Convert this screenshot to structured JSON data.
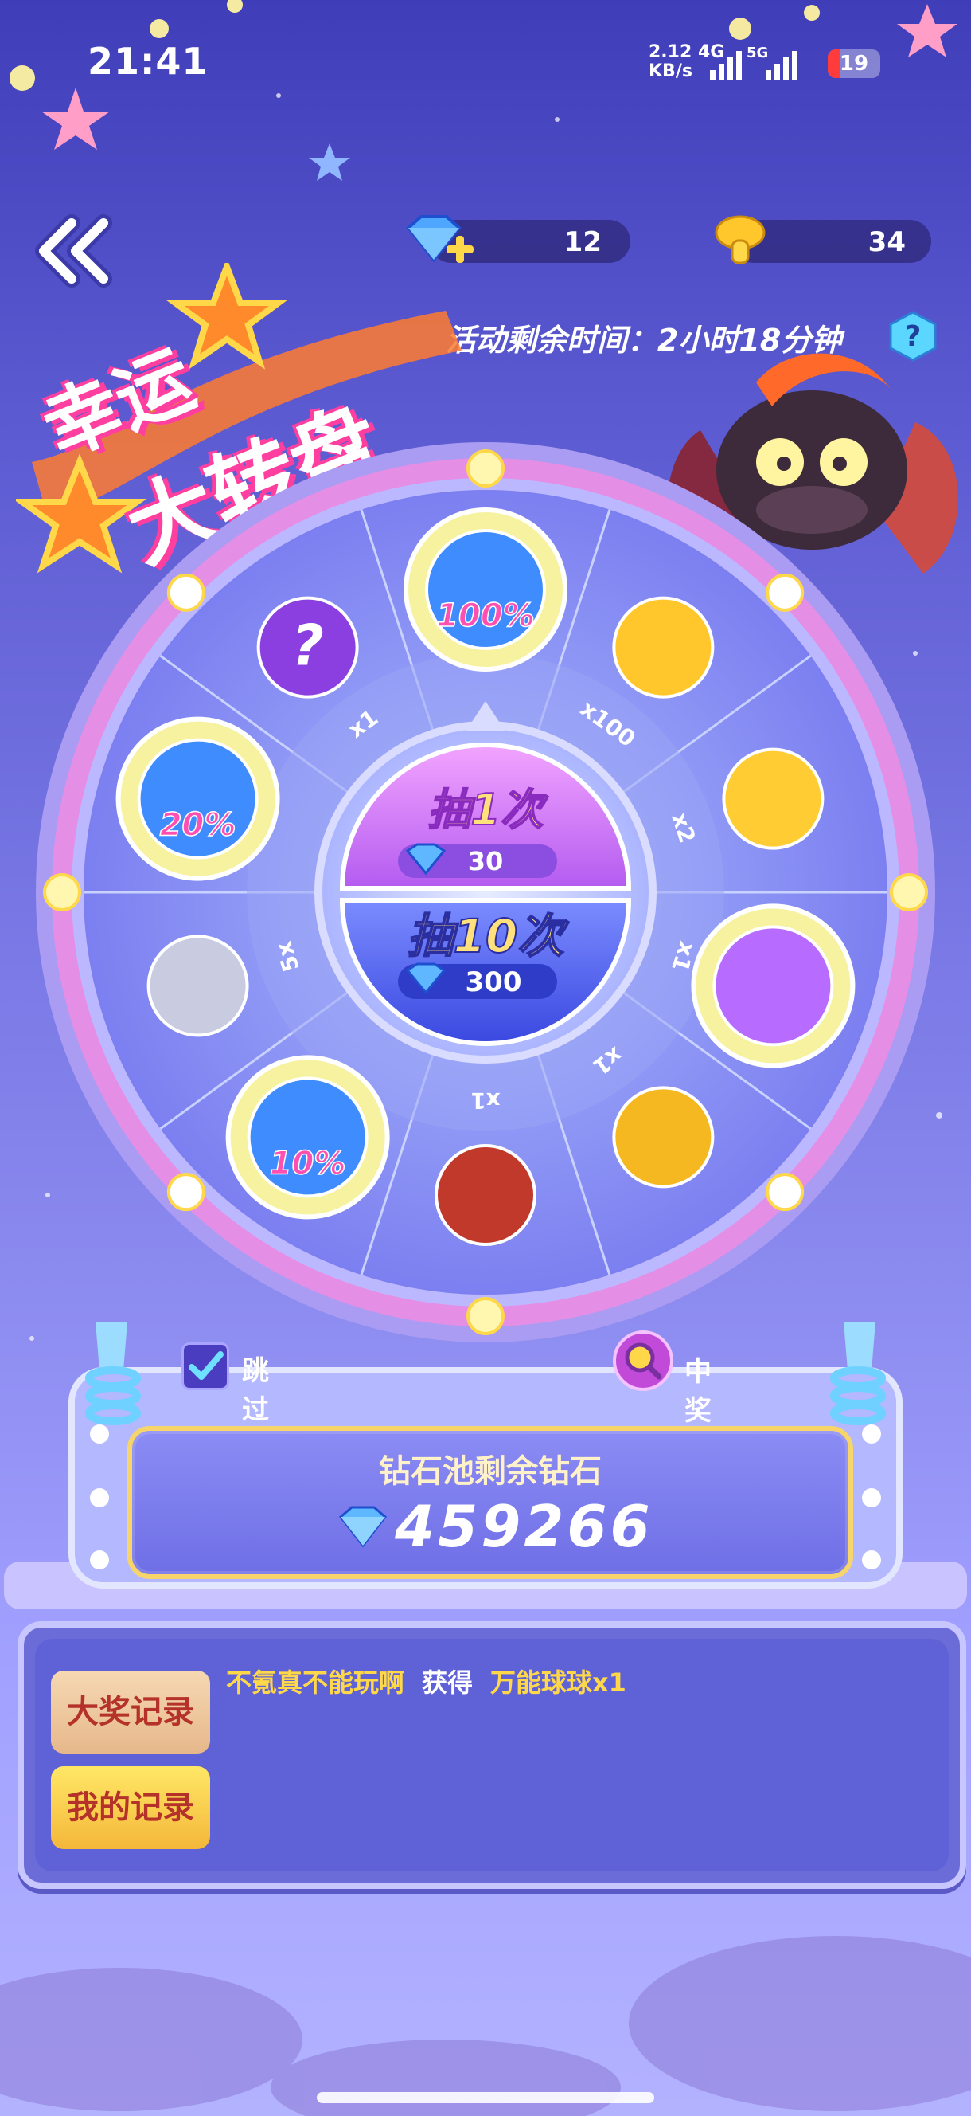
{
  "status_bar": {
    "time": "21:41",
    "net_speed": "2.12",
    "net_unit": "KB/s",
    "net_type_1": "4G",
    "net_type_2": "5G",
    "battery": "19"
  },
  "header": {
    "diamonds": "12",
    "mushrooms": "34",
    "timer_text": "活动剩余时间：2小时18分钟",
    "help_label": "?"
  },
  "title": {
    "line1": "幸运",
    "line2": "大转盘"
  },
  "wheel": {
    "segments": [
      {
        "icon": "gem-pile-icon",
        "label": "100%",
        "qty": ""
      },
      {
        "icon": "gold-coins-icon",
        "label": "",
        "qty": "x100"
      },
      {
        "icon": "gold-mushroom-icon",
        "label": "",
        "qty": "x2"
      },
      {
        "icon": "universal-ball-icon",
        "label": "",
        "qty": "x1"
      },
      {
        "icon": "gold-egg-icon",
        "label": "",
        "qty": "x1"
      },
      {
        "icon": "treasure-chest-icon",
        "label": "",
        "qty": "x1"
      },
      {
        "icon": "gem-pile-icon",
        "label": "10%",
        "qty": ""
      },
      {
        "icon": "silver-mushroom-icon",
        "label": "",
        "qty": "5x"
      },
      {
        "icon": "gem-pile-icon",
        "label": "20%",
        "qty": ""
      },
      {
        "icon": "mystery-ball-icon",
        "label": "?",
        "qty": "x1"
      }
    ],
    "draw_once_label": "抽1次",
    "draw_once_cost": "30",
    "draw_ten_label": "抽10次",
    "draw_ten_cost": "300"
  },
  "controls": {
    "skip_label": "跳过动画",
    "skip_checked": true,
    "prob_label": "中奖概率"
  },
  "pool": {
    "title": "钻石池剩余钻石",
    "value": "459266"
  },
  "records": {
    "tab_grand": "大奖记录",
    "tab_mine": "我的记录",
    "entries": [
      {
        "user": "不氪真不能玩啊",
        "action": "获得",
        "item": "万能球球x1"
      }
    ]
  },
  "colors": {
    "accent_gold": "#ffd84a",
    "wheel_rim": "#e58ee6",
    "bg_top": "#3f3db8",
    "bg_bottom": "#b3b2ff"
  }
}
